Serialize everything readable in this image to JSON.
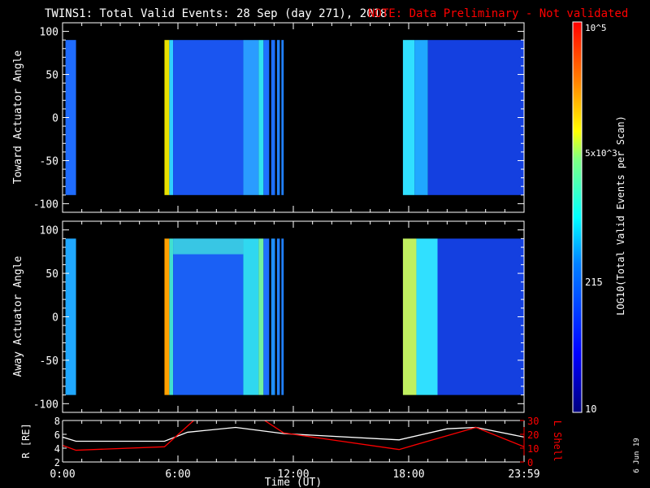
{
  "chart_data": {
    "type": "heatmap",
    "title": "TWINS1: Total Valid Events: 28 Sep (day 271), 2018",
    "note": "NOTE: Data Preliminary - Not validated",
    "note_color": "#ff0000",
    "xlabel": "Time (UT)",
    "x_ticks": [
      "0:00",
      "6:00",
      "12:00",
      "18:00",
      "23:59"
    ],
    "x_tick_values": [
      0,
      6,
      12,
      18,
      24
    ],
    "xlim": [
      0,
      24
    ],
    "panels": [
      {
        "ylabel": "Toward Actuator Angle",
        "ylim": [
          -110,
          110
        ],
        "y_ticks": [
          100,
          50,
          0,
          -50,
          -100
        ],
        "segments": [
          [
            0.15,
            0.7,
            "#1f6cff"
          ],
          [
            5.3,
            5.55,
            "#e8e000"
          ],
          [
            5.55,
            5.75,
            "#30d0ff"
          ],
          [
            5.75,
            9.4,
            "#1a55f0"
          ],
          [
            9.4,
            10.2,
            "#2a9cff"
          ],
          [
            10.2,
            10.45,
            "#30e0f0"
          ],
          [
            10.45,
            10.75,
            "#1e70ff"
          ],
          [
            10.75,
            10.85,
            "#000000"
          ],
          [
            10.85,
            11.05,
            "#1e70ff"
          ],
          [
            11.05,
            11.15,
            "#000000"
          ],
          [
            11.15,
            11.3,
            "#2080ff"
          ],
          [
            11.3,
            11.38,
            "#000000"
          ],
          [
            11.38,
            11.5,
            "#2080ff"
          ],
          [
            17.7,
            18.3,
            "#30e0ff"
          ],
          [
            18.3,
            19.0,
            "#20a8ff"
          ],
          [
            19.0,
            24,
            "#1440e0"
          ]
        ]
      },
      {
        "ylabel": "Away Actuator Angle",
        "ylim": [
          -110,
          110
        ],
        "y_ticks": [
          100,
          50,
          0,
          -50,
          -100
        ],
        "segments": [
          [
            0.15,
            0.7,
            "#20a8ff"
          ],
          [
            5.3,
            5.55,
            "#ffa000"
          ],
          [
            5.55,
            5.75,
            "#40e0d0"
          ],
          [
            5.75,
            9.4,
            "#1a60f5"
          ],
          [
            9.4,
            10.2,
            "#30d8f0"
          ],
          [
            10.2,
            10.45,
            "#70f0a0"
          ],
          [
            10.45,
            10.75,
            "#1e70ff"
          ],
          [
            10.75,
            10.85,
            "#000000"
          ],
          [
            10.85,
            11.05,
            "#2090ff"
          ],
          [
            11.05,
            11.15,
            "#000000"
          ],
          [
            11.15,
            11.3,
            "#2080ff"
          ],
          [
            11.3,
            11.38,
            "#000000"
          ],
          [
            11.38,
            11.5,
            "#2080ff"
          ],
          [
            17.7,
            18.4,
            "#c0f060"
          ],
          [
            18.4,
            19.5,
            "#30e0ff"
          ],
          [
            19.5,
            24,
            "#1440e0"
          ]
        ]
      }
    ],
    "colorbar": {
      "label": "LOG10(Total Valid Events per Scan)",
      "ticks": [
        "10^5",
        "5x10^3",
        "215",
        "10"
      ],
      "range": [
        10,
        100000
      ]
    },
    "orbit": {
      "left_label": "R [RE]",
      "left_ylim": [
        2,
        8
      ],
      "left_ticks": [
        2,
        4,
        6,
        8
      ],
      "right_label": "L Shell",
      "right_ylim": [
        0,
        30
      ],
      "right_ticks": [
        0,
        10,
        20,
        30
      ],
      "R": [
        [
          0,
          5.6
        ],
        [
          0.7,
          5
        ],
        [
          5.3,
          5
        ],
        [
          6.5,
          6.3
        ],
        [
          9,
          7
        ],
        [
          11.5,
          6.1
        ],
        [
          17.5,
          5.2
        ],
        [
          20,
          6.8
        ],
        [
          21.5,
          7
        ],
        [
          24,
          5.6
        ]
      ],
      "L": [
        [
          0,
          12
        ],
        [
          0.7,
          8.5
        ],
        [
          5.3,
          11
        ],
        [
          6.9,
          31
        ],
        null,
        [
          10.4,
          31
        ],
        [
          11.5,
          21
        ],
        [
          17.5,
          9
        ],
        [
          21.5,
          25
        ],
        [
          24,
          11
        ]
      ]
    },
    "date_stamp": "6 Jun 19"
  }
}
